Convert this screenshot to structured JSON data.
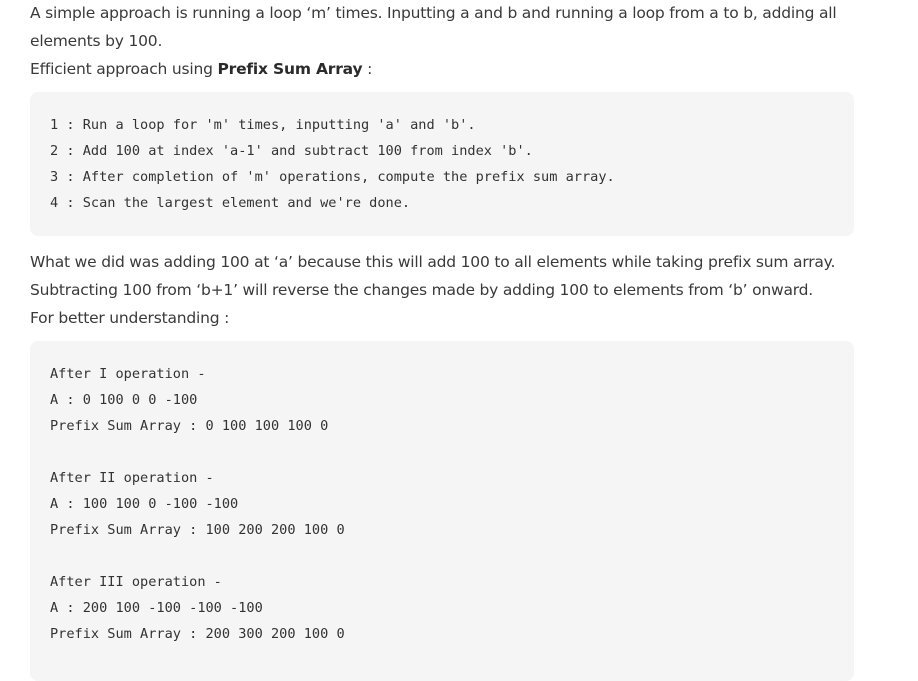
{
  "intro": {
    "line1": "A simple approach is running a loop ‘m’ times. Inputting a and b and running a loop from a to b, adding all",
    "line2": "elements by 100.",
    "efficient_prefix": "Efficient approach using ",
    "efficient_bold": "Prefix Sum Array",
    "efficient_suffix": " :"
  },
  "steps_code": [
    "1 : Run a loop for 'm' times, inputting 'a' and 'b'.",
    "2 : Add 100 at index 'a-1' and subtract 100 from index 'b'.",
    "3 : After completion of 'm' operations, compute the prefix sum array.",
    "4 : Scan the largest element and we're done."
  ],
  "explanation": {
    "line1": "What we did was adding 100 at ‘a’ because this will add 100 to all elements while taking prefix sum array.",
    "line2": "Subtracting 100 from ‘b+1’ will reverse the changes made by adding 100 to elements from ‘b’ onward.",
    "line3": "For better understanding :"
  },
  "example_code": [
    "After I operation -",
    "A : 0 100 0 0 -100",
    "Prefix Sum Array : 0 100 100 100 0",
    "",
    "After II operation -",
    "A : 100 100 0 -100 -100",
    "Prefix Sum Array : 100 200 200 100 0",
    "",
    "After III operation -",
    "A : 200 100 -100 -100 -100",
    "Prefix Sum Array : 200 300 200 100 0"
  ]
}
